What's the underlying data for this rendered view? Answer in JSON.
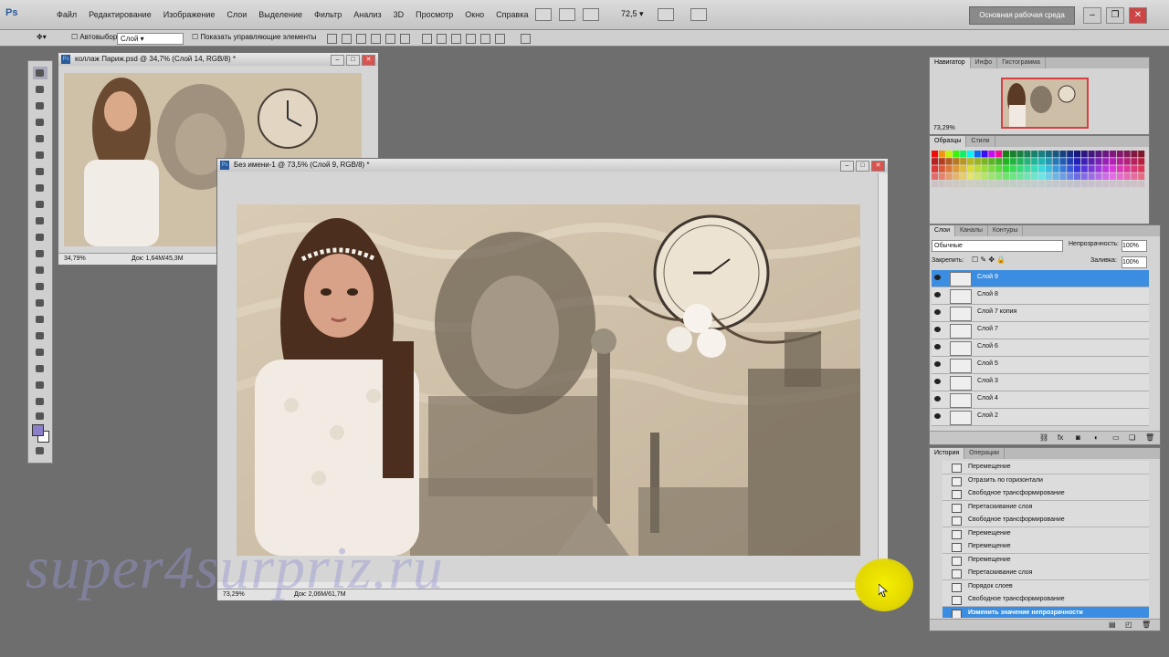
{
  "app": {
    "logo": "Ps"
  },
  "menu": [
    "Файл",
    "Редактирование",
    "Изображение",
    "Слои",
    "Выделение",
    "Фильтр",
    "Анализ",
    "3D",
    "Просмотр",
    "Окно",
    "Справка"
  ],
  "menubar": {
    "zoom": "72,5",
    "workspace": "Основная рабочая среда"
  },
  "options": {
    "autoselect_label": "Автовыбор:",
    "autoselect_value": "Слой",
    "show_controls": "Показать управляющие элементы"
  },
  "doc1": {
    "title": "коллаж Париж.psd @ 34,7% (Слой 14, RGB/8) *",
    "zoom": "34,79%",
    "info": "Док: 1,64M/45,3M"
  },
  "doc2": {
    "title": "Без имени-1 @ 73,5% (Слой 9, RGB/8) *",
    "zoom": "73,29%",
    "info": "Док: 2,06M/61,7M"
  },
  "navigator": {
    "tabs": [
      "Навигатор",
      "Инфо",
      "Гистограмма"
    ],
    "zoom": "73,29%"
  },
  "swatches_panel": {
    "tabs": [
      "Образцы",
      "Стили"
    ]
  },
  "layers": {
    "tabs": [
      "Слои",
      "Каналы",
      "Контуры"
    ],
    "blend": "Обычные",
    "opacity_label": "Непрозрачность:",
    "opacity": "100%",
    "lock_label": "Закрепить:",
    "fill_label": "Заливка:",
    "fill": "100%",
    "items": [
      {
        "name": "Слой 9",
        "selected": true
      },
      {
        "name": "Слой 8",
        "selected": false
      },
      {
        "name": "Слой 7 копия",
        "selected": false
      },
      {
        "name": "Слой 7",
        "selected": false
      },
      {
        "name": "Слой 6",
        "selected": false
      },
      {
        "name": "Слой 5",
        "selected": false
      },
      {
        "name": "Слой 3",
        "selected": false
      },
      {
        "name": "Слой 4",
        "selected": false
      },
      {
        "name": "Слой 2",
        "selected": false
      }
    ]
  },
  "history": {
    "tabs": [
      "История",
      "Операции"
    ],
    "items": [
      {
        "name": "Перемещение",
        "selected": false
      },
      {
        "name": "Отразить по горизонтали",
        "selected": false
      },
      {
        "name": "Свободное трансформирование",
        "selected": false
      },
      {
        "name": "Перетаскивание слоя",
        "selected": false
      },
      {
        "name": "Свободное трансформирование",
        "selected": false
      },
      {
        "name": "Перемещение",
        "selected": false
      },
      {
        "name": "Перемещение",
        "selected": false
      },
      {
        "name": "Перемещение",
        "selected": false
      },
      {
        "name": "Перетаскивание слоя",
        "selected": false
      },
      {
        "name": "Порядок слоев",
        "selected": false
      },
      {
        "name": "Свободное трансформирование",
        "selected": false
      },
      {
        "name": "Изменить значение непрозрачности",
        "selected": true
      }
    ]
  },
  "watermark": "super4surpriz.ru",
  "colors": {
    "selection": "#3a8de0",
    "foreground": "#8a7fc8",
    "cursor_highlight": "#f0e800"
  }
}
